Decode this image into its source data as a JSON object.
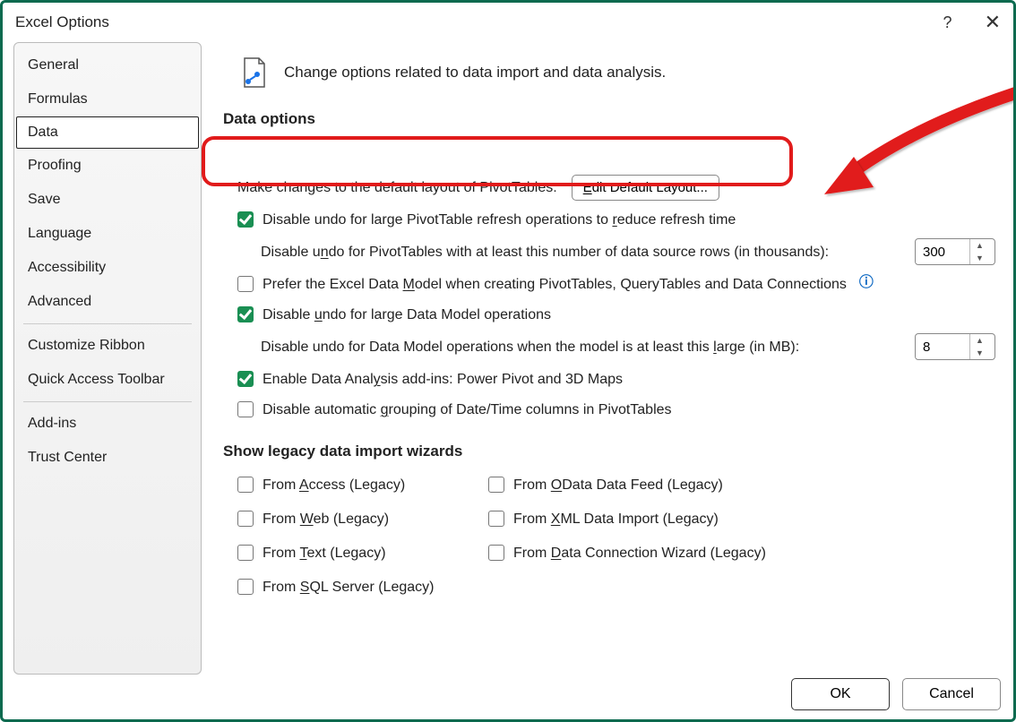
{
  "window": {
    "title": "Excel Options"
  },
  "nav": {
    "items": [
      "General",
      "Formulas",
      "Data",
      "Proofing",
      "Save",
      "Language",
      "Accessibility",
      "Advanced"
    ],
    "items2": [
      "Customize Ribbon",
      "Quick Access Toolbar"
    ],
    "items3": [
      "Add-ins",
      "Trust Center"
    ],
    "selected": "Data"
  },
  "intro": "Change options related to data import and data analysis.",
  "sections": {
    "data_options": "Data options",
    "legacy": "Show legacy data import wizards"
  },
  "pivot": {
    "row_label": "Make changes to the default layout of PivotTables:",
    "btn": "Edit Default Layout..."
  },
  "opts": {
    "disable_undo_refresh": "Disable undo for large PivotTable refresh operations to reduce refresh time",
    "rows_label": "Disable undo for PivotTables with at least this number of data source rows (in thousands):",
    "rows_value": "300",
    "prefer_model": "Prefer the Excel Data Model when creating PivotTables, QueryTables and Data Connections",
    "disable_undo_model": "Disable undo for large Data Model operations",
    "model_mb_label": "Disable undo for Data Model operations when the model is at least this large (in MB):",
    "model_mb_value": "8",
    "enable_addins": "Enable Data Analysis add-ins: Power Pivot and 3D Maps",
    "disable_autogroup": "Disable automatic grouping of Date/Time columns in PivotTables"
  },
  "legacy": {
    "access": "From Access (Legacy)",
    "web": "From Web (Legacy)",
    "text": "From Text (Legacy)",
    "sql": "From SQL Server (Legacy)",
    "odata": "From OData Data Feed (Legacy)",
    "xml": "From XML Data Import (Legacy)",
    "wizard": "From Data Connection Wizard (Legacy)"
  },
  "footer": {
    "ok": "OK",
    "cancel": "Cancel"
  }
}
